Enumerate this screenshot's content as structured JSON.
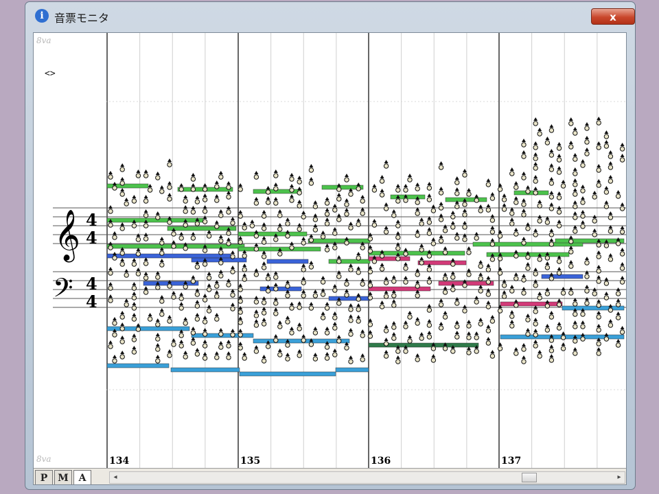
{
  "window": {
    "title": "音票モニタ",
    "close_label": "x"
  },
  "score": {
    "ottava_top": "8va",
    "ottava_bottom": "8va",
    "marker": "<>",
    "measures": [
      "134",
      "135",
      "136",
      "137"
    ]
  },
  "tabs": [
    {
      "label": "P"
    },
    {
      "label": "M"
    },
    {
      "label": "A"
    }
  ],
  "scrollbar": {
    "left_arrow": "◂",
    "right_arrow": "▸"
  },
  "colors": {
    "green": "#4cc24c",
    "blue": "#3a63d8",
    "cyan": "#3aa0d8",
    "magenta": "#d23a78",
    "darkgreen": "#2f7a4a"
  }
}
